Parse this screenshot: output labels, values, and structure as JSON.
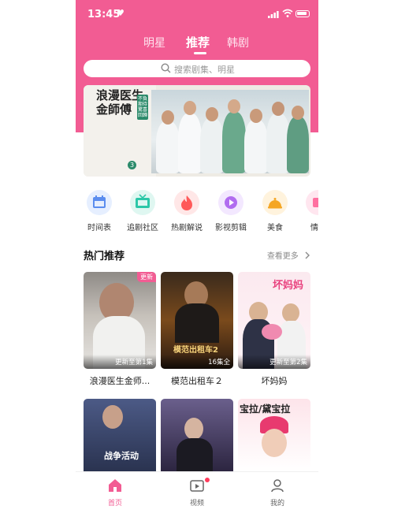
{
  "status_bar": {
    "time": "13:45"
  },
  "top_tabs": [
    {
      "label": "明星"
    },
    {
      "label": "推荐",
      "active": true
    },
    {
      "label": "韩剧"
    }
  ],
  "search": {
    "placeholder": "搜索剧集、明星"
  },
  "banner": {
    "title": "浪漫医生金師傅",
    "season": "3",
    "tag": "不負期待 驚喜回歸"
  },
  "quick_icons": [
    {
      "label": "时间表",
      "icon": "calendar-icon",
      "color": "#5b8def"
    },
    {
      "label": "追剧社区",
      "icon": "tv-icon",
      "color": "#2cc7a8"
    },
    {
      "label": "热剧解说",
      "icon": "flame-icon",
      "color": "#ff5a5a"
    },
    {
      "label": "影视剪辑",
      "icon": "play-icon",
      "color": "#b16cf0"
    },
    {
      "label": "美食",
      "icon": "food-cover-icon",
      "color": "#f5a623"
    },
    {
      "label": "情感",
      "icon": "heart-box-icon",
      "color": "#ff6fa0"
    }
  ],
  "section": {
    "title": "热门推荐",
    "more": "查看更多"
  },
  "cards": [
    {
      "name": "浪漫医生金师...",
      "status": "更新至第1集",
      "badge": "更新"
    },
    {
      "name": "模范出租车２",
      "status": "16集全",
      "poster_text": "模范出租车2"
    },
    {
      "name": "坏妈妈",
      "status": "更新至第2集",
      "poster_text": "坏妈妈"
    }
  ],
  "row2": [
    {
      "poster_text": "战争活动"
    },
    {
      "poster_text": ""
    },
    {
      "poster_text": "宝拉/黛宝拉"
    }
  ],
  "bottom_nav": [
    {
      "label": "首页",
      "icon": "home-icon",
      "active": true
    },
    {
      "label": "视频",
      "icon": "video-icon"
    },
    {
      "label": "我的",
      "icon": "profile-icon"
    }
  ],
  "colors": {
    "brand_pink": "#f25c93"
  }
}
